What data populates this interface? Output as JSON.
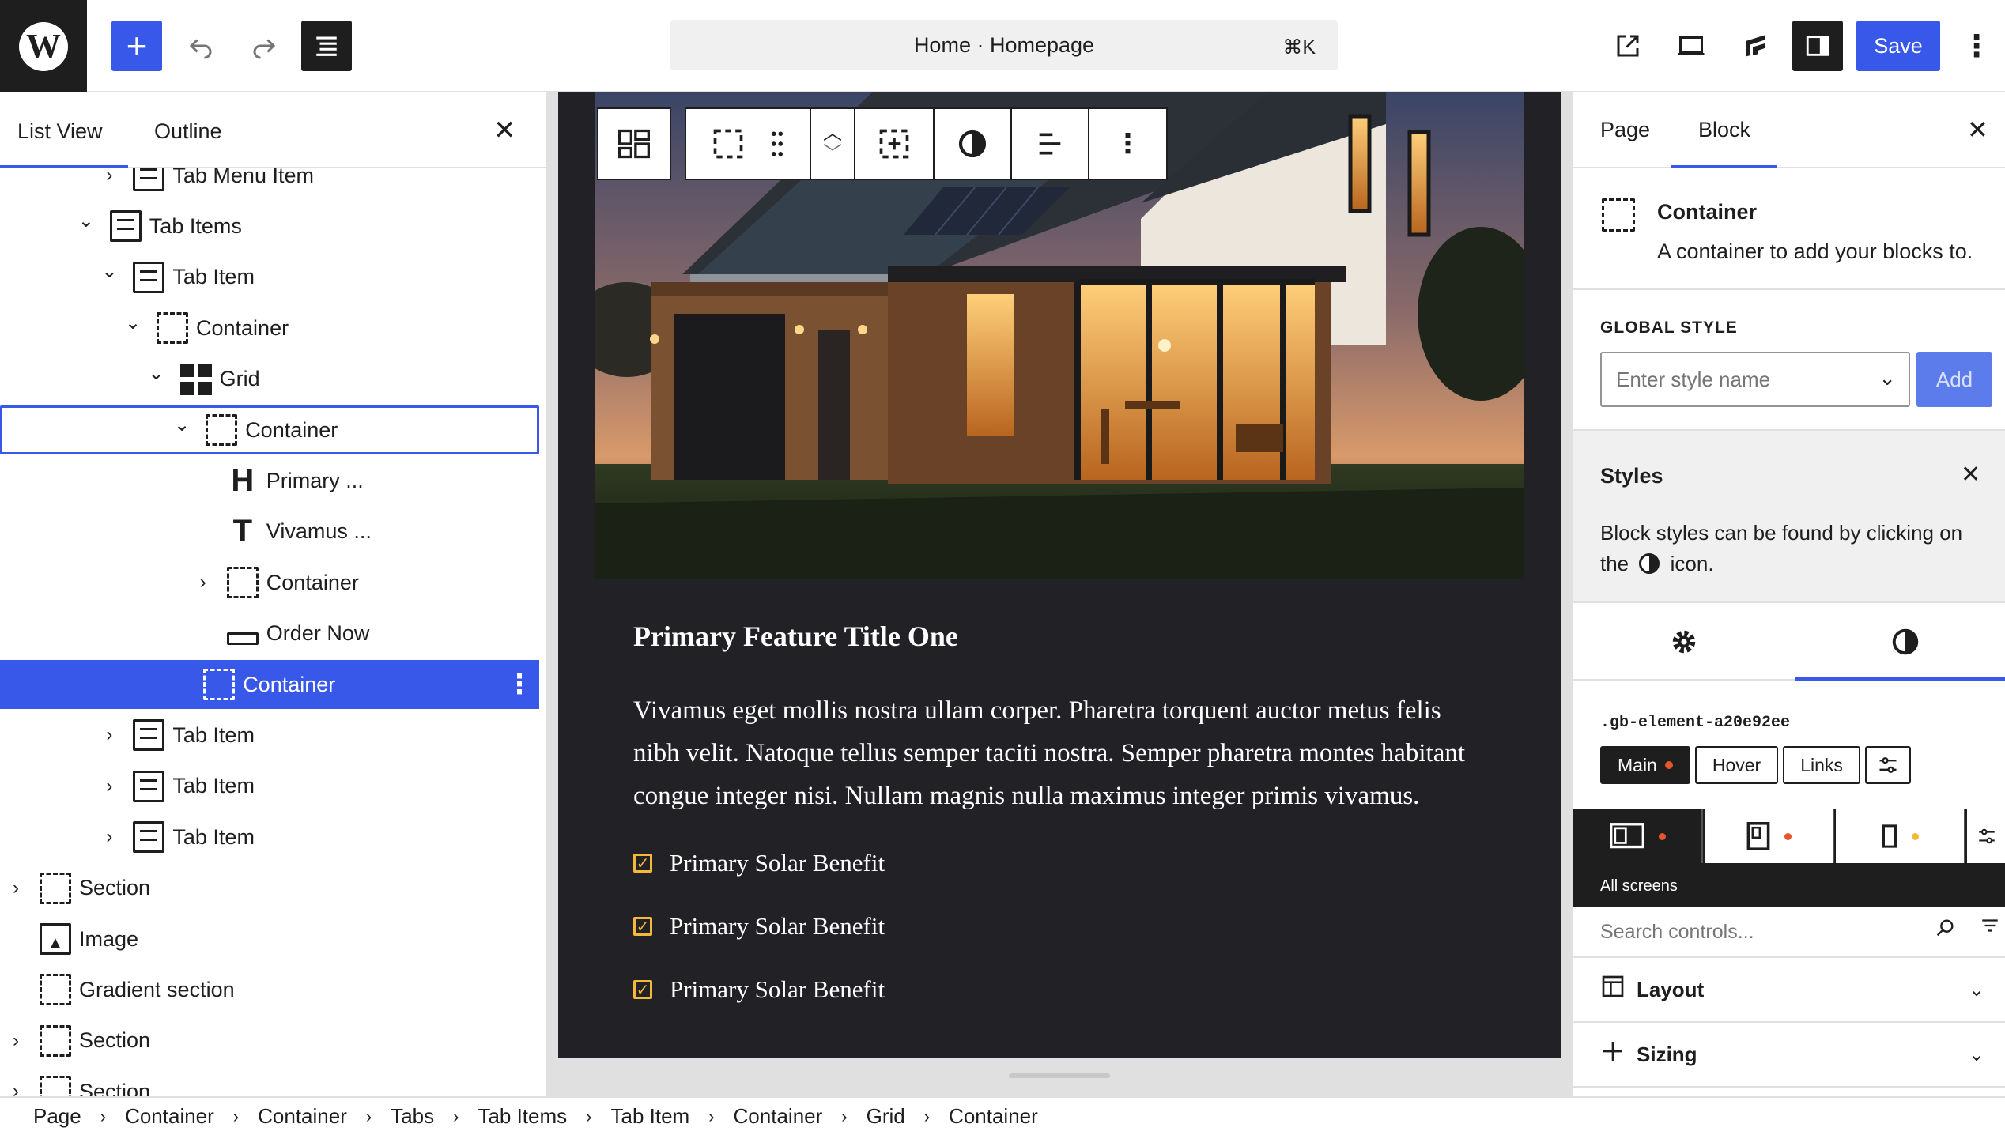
{
  "topbar": {
    "add_icon": "plus-icon",
    "undo_icon": "undo-icon",
    "redo_icon": "redo-icon",
    "document_overview_icon": "list-view-icon",
    "command_title": "Home · Homepage",
    "command_shortcut": "⌘K",
    "save_label": "Save",
    "accent": "#3858e9"
  },
  "left_panel": {
    "tabs": [
      "List View",
      "Outline"
    ],
    "active_tab": "List View",
    "tree": [
      {
        "label": "Tab Menu Item",
        "icon": "doc-icon",
        "depth": 4,
        "chevron": "right"
      },
      {
        "label": "Tab Items",
        "icon": "doc-icon",
        "depth": 3,
        "chevron": "down"
      },
      {
        "label": "Tab Item",
        "icon": "doc-icon",
        "depth": 4,
        "chevron": "down"
      },
      {
        "label": "Container",
        "icon": "container-icon",
        "depth": 5,
        "chevron": "down"
      },
      {
        "label": "Grid",
        "icon": "grid-icon",
        "depth": 6,
        "chevron": "down"
      },
      {
        "label": "Container",
        "icon": "container-icon",
        "depth": 7,
        "chevron": "down",
        "state": "outlined"
      },
      {
        "label": "Primary ...",
        "icon": "heading-icon",
        "depth": 8,
        "chevron": ""
      },
      {
        "label": "Vivamus ...",
        "icon": "text-icon",
        "depth": 8,
        "chevron": ""
      },
      {
        "label": "Container",
        "icon": "container-icon",
        "depth": 8,
        "chevron": "right"
      },
      {
        "label": "Order Now",
        "icon": "button-icon",
        "depth": 8,
        "chevron": ""
      },
      {
        "label": "Container",
        "icon": "container-icon",
        "depth": 7,
        "chevron": "",
        "state": "selected"
      },
      {
        "label": "Tab Item",
        "icon": "doc-icon",
        "depth": 4,
        "chevron": "right"
      },
      {
        "label": "Tab Item",
        "icon": "doc-icon",
        "depth": 4,
        "chevron": "right"
      },
      {
        "label": "Tab Item",
        "icon": "doc-icon",
        "depth": 4,
        "chevron": "right"
      },
      {
        "label": "Section",
        "icon": "container-icon",
        "depth": 0,
        "chevron": "right"
      },
      {
        "label": "Image",
        "icon": "image-icon",
        "depth": 0,
        "chevron": ""
      },
      {
        "label": "Gradient section",
        "icon": "container-icon",
        "depth": 0,
        "chevron": ""
      },
      {
        "label": "Section",
        "icon": "container-icon",
        "depth": 0,
        "chevron": "right"
      },
      {
        "label": "Section",
        "icon": "container-icon",
        "depth": 0,
        "chevron": "right"
      }
    ]
  },
  "canvas": {
    "feature_title": "Primary Feature Title One",
    "feature_body": "Vivamus eget mollis nostra ullam corper. Pharetra torquent auctor metus felis nibh velit. Natoque tellus semper taciti nostra. Semper pharetra montes habitant congue integer nisi. Nullam magnis nulla maximus integer primis vivamus.",
    "benefits": [
      "Primary Solar Benefit",
      "Primary Solar Benefit",
      "Primary Solar Benefit"
    ],
    "check_color": "#f5b93a",
    "card_bg": "#222226"
  },
  "block_toolbar": {
    "items": [
      "parent-grid-icon",
      "container-icon",
      "drag-handle-icon",
      "move-up-down-icon",
      "container-add-icon",
      "styles-icon",
      "align-icon",
      "more-options-icon"
    ]
  },
  "right_panel": {
    "tabs": [
      "Page",
      "Block"
    ],
    "active_tab": "Block",
    "block_name": "Container",
    "block_description": "A container to add your blocks to.",
    "global_style_label": "GLOBAL STYLE",
    "global_style_placeholder": "Enter style name",
    "global_style_add": "Add",
    "styles_title": "Styles",
    "styles_text_before": "Block styles can be found by clicking on the",
    "styles_text_after": "icon.",
    "selector": ".gb-element-a20e92ee",
    "states": [
      {
        "label": "Main",
        "active": true,
        "dot": true
      },
      {
        "label": "Hover",
        "active": false,
        "dot": false
      },
      {
        "label": "Links",
        "active": false,
        "dot": false
      }
    ],
    "device_label": "All screens",
    "device_dots": [
      "#e5572b",
      "#e5572b",
      "#f5b93a"
    ],
    "search_placeholder": "Search controls...",
    "accordions": [
      {
        "label": "Layout",
        "icon": "layout-icon"
      },
      {
        "label": "Sizing",
        "icon": "sizing-icon"
      }
    ]
  },
  "breadcrumb": [
    "Page",
    "Container",
    "Container",
    "Tabs",
    "Tab Items",
    "Tab Item",
    "Container",
    "Grid",
    "Container"
  ]
}
